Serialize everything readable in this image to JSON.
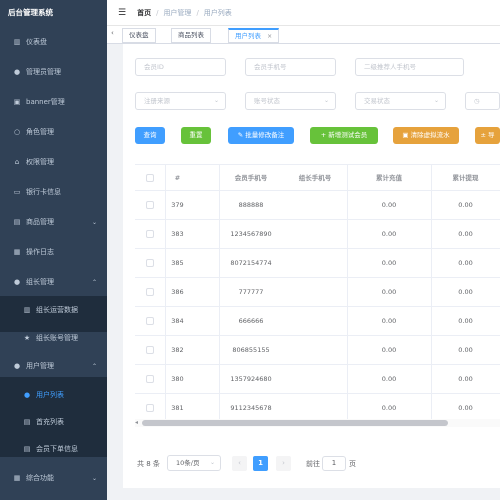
{
  "sidebar": {
    "title": "后台管理系统",
    "items": [
      {
        "label": "仪表盘",
        "icon": "bar-chart-icon"
      },
      {
        "label": "管理员管理",
        "icon": "user-icon"
      },
      {
        "label": "banner管理",
        "icon": "image-icon"
      },
      {
        "label": "角色管理",
        "icon": "user-outline-icon"
      },
      {
        "label": "权限管理",
        "icon": "lock-icon"
      },
      {
        "label": "银行卡信息",
        "icon": "card-icon"
      },
      {
        "label": "商品管理",
        "icon": "goods-icon"
      },
      {
        "label": "操作日志",
        "icon": "log-icon"
      },
      {
        "label": "组长管理",
        "icon": "user-icon"
      },
      {
        "label": "组长运营数据",
        "icon": "bar-chart-icon"
      },
      {
        "label": "组长账号管理",
        "icon": "star-icon"
      },
      {
        "label": "用户管理",
        "icon": "user-icon"
      },
      {
        "label": "用户列表",
        "icon": "user-icon"
      },
      {
        "label": "首充列表",
        "icon": "list-icon"
      },
      {
        "label": "会员下单信息",
        "icon": "list-icon"
      },
      {
        "label": "综合功能",
        "icon": "grid-icon"
      }
    ]
  },
  "header": {
    "breadcrumb": [
      "首页",
      "用户管理",
      "用户列表"
    ],
    "separator": "/"
  },
  "tabs": [
    {
      "label": "仪表盘"
    },
    {
      "label": "商品列表"
    },
    {
      "label": "用户列表",
      "close": "×"
    }
  ],
  "filters": {
    "member_id": "会员ID",
    "member_phone": "会员手机号",
    "referrer_phone": "二级推荐人手机号",
    "register_source": "注册来源",
    "account_status": "账号状态",
    "trade_status": "交易状态"
  },
  "buttons": {
    "search": "查询",
    "reset": "重置",
    "batch_edit": "批量修改备注",
    "add_test": "新增测试会员",
    "clear_flow": "清除虚拟流水",
    "export": "导"
  },
  "table": {
    "headers": [
      "#",
      "会员手机号",
      "组长手机号",
      "累计充值",
      "累计提现"
    ],
    "rows": [
      {
        "id": "379",
        "phone": "888888",
        "leader": "",
        "recharge": "0.00",
        "withdraw": "0.00"
      },
      {
        "id": "383",
        "phone": "1234567890",
        "leader": "",
        "recharge": "0.00",
        "withdraw": "0.00"
      },
      {
        "id": "385",
        "phone": "8072154774",
        "leader": "",
        "recharge": "0.00",
        "withdraw": "0.00"
      },
      {
        "id": "386",
        "phone": "777777",
        "leader": "",
        "recharge": "0.00",
        "withdraw": "0.00"
      },
      {
        "id": "384",
        "phone": "666666",
        "leader": "",
        "recharge": "0.00",
        "withdraw": "0.00"
      },
      {
        "id": "382",
        "phone": "806855155",
        "leader": "",
        "recharge": "0.00",
        "withdraw": "0.00"
      },
      {
        "id": "380",
        "phone": "1357924680",
        "leader": "",
        "recharge": "0.00",
        "withdraw": "0.00"
      },
      {
        "id": "381",
        "phone": "9112345678",
        "leader": "",
        "recharge": "0.00",
        "withdraw": "0.00"
      }
    ]
  },
  "pagination": {
    "total": "共 8 条",
    "page_size": "10条/页",
    "current_page": "1",
    "goto_label": "前往",
    "goto_value": "1",
    "page_suffix": "页"
  },
  "colors": {
    "primary": "#409eff",
    "success": "#67c23a",
    "warning": "#e6a23c",
    "sidebar_bg": "#304156"
  }
}
